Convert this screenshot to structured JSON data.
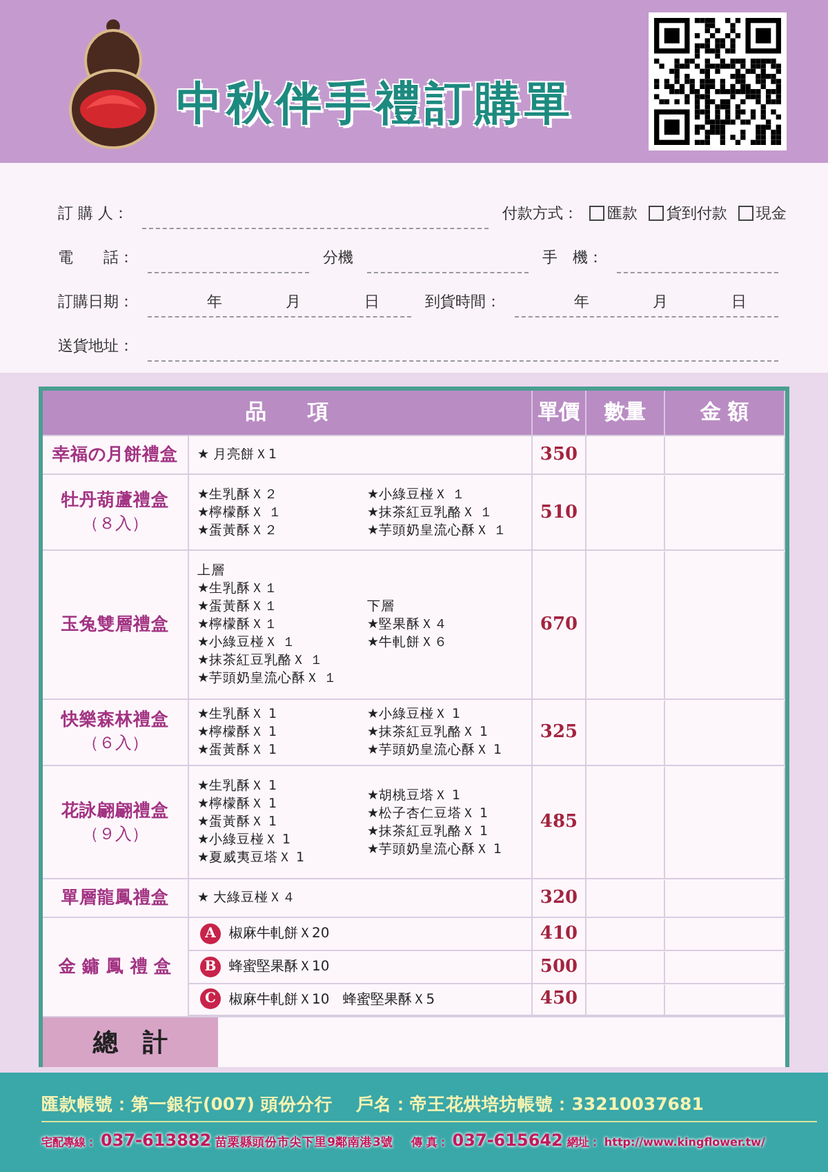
{
  "header": {
    "title": "中秋伴手禮訂購單"
  },
  "form": {
    "rows": [
      {
        "fields": [
          {
            "label": "訂 購 人：",
            "kind": "blank"
          },
          {
            "label": "付款方式：",
            "kind": "choices",
            "options": [
              {
                "text": "匯款",
                "checked": false
              },
              {
                "text": "貨到付款",
                "checked": false
              },
              {
                "text": "現金",
                "checked": false
              }
            ]
          }
        ]
      },
      {
        "fields": [
          {
            "label": "電　　話：",
            "kind": "blank"
          },
          {
            "label": "分機",
            "kind": "blank"
          },
          {
            "label": "手　機：",
            "kind": "blank"
          }
        ]
      },
      {
        "fields": [
          {
            "label": "訂購日期：",
            "kind": "date",
            "units": [
              "年",
              "月",
              "日"
            ]
          },
          {
            "label": "到貨時間：",
            "kind": "date",
            "units": [
              "年",
              "月",
              "日"
            ]
          }
        ]
      },
      {
        "fields": [
          {
            "label": "送貨地址：",
            "kind": "blank"
          }
        ]
      }
    ]
  },
  "table": {
    "columns": [
      "品　　項",
      "單價",
      "數量",
      "金 額"
    ],
    "rows": [
      {
        "kind": "standard",
        "name": "幸福の月餅禮盒",
        "columns": [
          {
            "lines": [
              "★ 月亮餅Ｘ1"
            ]
          }
        ],
        "price": "350"
      },
      {
        "kind": "standard",
        "name": "牡丹葫蘆禮盒",
        "count": "（８入）",
        "columns": [
          {
            "lines": [
              "★生乳酥Ｘ２",
              "★檸檬酥Ｘ １",
              "★蛋黃酥Ｘ２"
            ]
          },
          {
            "lines": [
              "★小綠豆椪Ｘ １",
              "★抹茶紅豆乳酪Ｘ １",
              "★芋頭奶皇流心酥Ｘ １"
            ]
          }
        ],
        "price": "510"
      },
      {
        "kind": "standard",
        "name": "玉兔雙層禮盒",
        "columns": [
          {
            "heading": "上層",
            "lines": [
              "★生乳酥Ｘ１",
              "★蛋黃酥Ｘ１",
              "★檸檬酥Ｘ１",
              "★小綠豆椪Ｘ １",
              "★抹茶紅豆乳酪Ｘ １",
              "★芋頭奶皇流心酥Ｘ １"
            ]
          },
          {
            "heading": "下層",
            "lines": [
              "★堅果酥Ｘ４",
              "★牛軋餅Ｘ６"
            ]
          }
        ],
        "price": "670"
      },
      {
        "kind": "standard",
        "name": "快樂森林禮盒",
        "count": "（６入）",
        "columns": [
          {
            "lines": [
              "★生乳酥Ｘ 1",
              "★檸檬酥Ｘ 1",
              "★蛋黃酥Ｘ 1"
            ]
          },
          {
            "lines": [
              "★小綠豆椪Ｘ 1",
              "★抹茶紅豆乳酪Ｘ 1",
              "★芋頭奶皇流心酥Ｘ 1"
            ]
          }
        ],
        "price": "325"
      },
      {
        "kind": "standard",
        "name": "花詠翩翩禮盒",
        "count": "（９入）",
        "columns": [
          {
            "lines": [
              "★生乳酥Ｘ 1",
              "★檸檬酥Ｘ 1",
              "★蛋黃酥Ｘ 1",
              "★小綠豆椪Ｘ 1",
              "★夏威夷豆塔Ｘ 1"
            ]
          },
          {
            "lines": [
              "★胡桃豆塔Ｘ 1",
              "★松子杏仁豆塔Ｘ 1",
              "★抹茶紅豆乳酪Ｘ 1",
              "★芋頭奶皇流心酥Ｘ 1"
            ]
          }
        ],
        "price": "485"
      },
      {
        "kind": "standard",
        "name": "單層龍鳳禮盒",
        "columns": [
          {
            "lines": [
              "★ 大綠豆椪Ｘ４"
            ]
          }
        ],
        "price": "320"
      },
      {
        "kind": "variants",
        "name": "金 鏞 鳳 禮 盒",
        "variants": [
          {
            "badge": "A",
            "contents": "椒麻牛軋餅Ｘ20",
            "price": "410"
          },
          {
            "badge": "B",
            "contents": "蜂蜜堅果酥Ｘ10",
            "price": "500"
          },
          {
            "badge": "C",
            "contents": "椒麻牛軋餅Ｘ10　蜂蜜堅果酥Ｘ5",
            "price": "450"
          }
        ]
      }
    ],
    "total": "總　計"
  },
  "footer": {
    "bank": "匯款帳號：第一銀行(007) 頭份分行　 戶名：帝王花烘培坊帳號：33210037681",
    "contacts": [
      {
        "label": "宅配專線：",
        "value": "037-613882"
      },
      {
        "kind": "note",
        "value": "苗栗縣頭份市尖下里9鄰南港3號"
      },
      {
        "label": "傳 真：",
        "value": "037-615642"
      },
      {
        "label": "網址：",
        "value": "http://www.kingflower.tw/",
        "kind": "link"
      }
    ]
  }
}
